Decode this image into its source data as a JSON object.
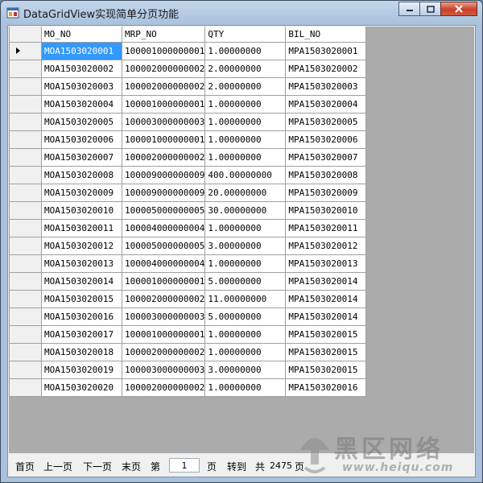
{
  "window": {
    "title": "DataGridView实现简单分页功能"
  },
  "grid": {
    "columns": [
      "MO_NO",
      "MRP_NO",
      "QTY",
      "BIL_NO"
    ],
    "rows": [
      [
        "MOA1503020001",
        "100001000000001",
        "1.00000000",
        "MPA1503020001"
      ],
      [
        "MOA1503020002",
        "100002000000002",
        "2.00000000",
        "MPA1503020002"
      ],
      [
        "MOA1503020003",
        "100002000000002",
        "2.00000000",
        "MPA1503020003"
      ],
      [
        "MOA1503020004",
        "100001000000001",
        "1.00000000",
        "MPA1503020004"
      ],
      [
        "MOA1503020005",
        "100003000000003",
        "1.00000000",
        "MPA1503020005"
      ],
      [
        "MOA1503020006",
        "100001000000001",
        "1.00000000",
        "MPA1503020006"
      ],
      [
        "MOA1503020007",
        "100002000000002",
        "1.00000000",
        "MPA1503020007"
      ],
      [
        "MOA1503020008",
        "100009000000009",
        "400.00000000",
        "MPA1503020008"
      ],
      [
        "MOA1503020009",
        "100009000000009",
        "20.00000000",
        "MPA1503020009"
      ],
      [
        "MOA1503020010",
        "100005000000005",
        "30.00000000",
        "MPA1503020010"
      ],
      [
        "MOA1503020011",
        "100004000000004",
        "1.00000000",
        "MPA1503020011"
      ],
      [
        "MOA1503020012",
        "100005000000005",
        "3.00000000",
        "MPA1503020012"
      ],
      [
        "MOA1503020013",
        "100004000000004",
        "1.00000000",
        "MPA1503020013"
      ],
      [
        "MOA1503020014",
        "100001000000001",
        "5.00000000",
        "MPA1503020014"
      ],
      [
        "MOA1503020015",
        "100002000000002",
        "11.00000000",
        "MPA1503020014"
      ],
      [
        "MOA1503020016",
        "100003000000003",
        "5.00000000",
        "MPA1503020014"
      ],
      [
        "MOA1503020017",
        "100001000000001",
        "1.00000000",
        "MPA1503020015"
      ],
      [
        "MOA1503020018",
        "100002000000002",
        "1.00000000",
        "MPA1503020015"
      ],
      [
        "MOA1503020019",
        "100003000000003",
        "3.00000000",
        "MPA1503020015"
      ],
      [
        "MOA1503020020",
        "100002000000002",
        "1.00000000",
        "MPA1503020016"
      ]
    ],
    "selected_color": "#3399ff"
  },
  "pager": {
    "first": "首页",
    "prev": "上一页",
    "next": "下一页",
    "last": "末页",
    "page_prefix": "第",
    "page_value": "1",
    "page_suffix": "页",
    "goto": "转到",
    "total_prefix": "共",
    "total_value": "2475",
    "total_suffix": "页"
  },
  "watermark": {
    "text": "黑区网络",
    "url": "www.heiqu.com"
  }
}
